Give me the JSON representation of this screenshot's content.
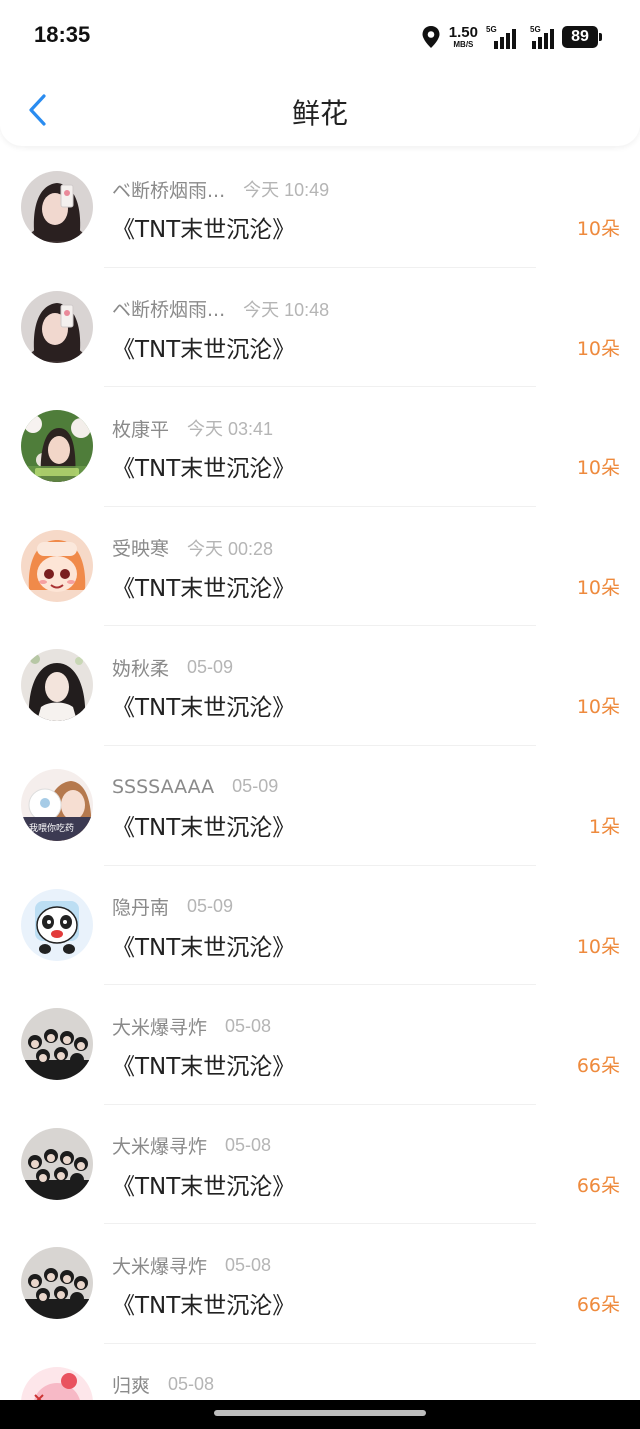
{
  "status_bar": {
    "time": "18:35",
    "net_speed_value": "1.50",
    "net_speed_unit": "MB/S",
    "sim1_tag": "5G",
    "sim2_tag": "5G",
    "battery": "89"
  },
  "header": {
    "back_icon": "chevron-left-icon",
    "title": "鲜花",
    "accent_color": "#2a8cf0"
  },
  "amount_color": "#ee8a3d",
  "items": [
    {
      "user": "ベ断桥烟雨...",
      "time": "今天 10:49",
      "book": "《TNT末世沉沦》",
      "amount": "10朵",
      "avatar": "girl-selfie"
    },
    {
      "user": "ベ断桥烟雨...",
      "time": "今天 10:48",
      "book": "《TNT末世沉沦》",
      "amount": "10朵",
      "avatar": "girl-selfie"
    },
    {
      "user": "枚康平",
      "time": "今天 03:41",
      "book": "《TNT末世沉沦》",
      "amount": "10朵",
      "avatar": "girl-flowers"
    },
    {
      "user": "受映寒",
      "time": "今天 00:28",
      "book": "《TNT末世沉沦》",
      "amount": "10朵",
      "avatar": "anime-girl"
    },
    {
      "user": "妫秋柔",
      "time": "05-09",
      "book": "《TNT末世沉沦》",
      "amount": "10朵",
      "avatar": "dark-hair-girl"
    },
    {
      "user": "SSSSAAAA",
      "time": "05-09",
      "book": "《TNT末世沉沦》",
      "amount": "1朵",
      "avatar": "sticker-girl"
    },
    {
      "user": "隐丹南",
      "time": "05-09",
      "book": "《TNT末世沉沦》",
      "amount": "10朵",
      "avatar": "panda"
    },
    {
      "user": "大米爆寻炸",
      "time": "05-08",
      "book": "《TNT末世沉沦》",
      "amount": "66朵",
      "avatar": "group-photo"
    },
    {
      "user": "大米爆寻炸",
      "time": "05-08",
      "book": "《TNT末世沉沦》",
      "amount": "66朵",
      "avatar": "group-photo"
    },
    {
      "user": "大米爆寻炸",
      "time": "05-08",
      "book": "《TNT末世沉沦》",
      "amount": "66朵",
      "avatar": "group-photo"
    },
    {
      "user": "归爽",
      "time": "05-08",
      "book": "",
      "amount": "",
      "avatar": "pink-cartoon"
    }
  ]
}
